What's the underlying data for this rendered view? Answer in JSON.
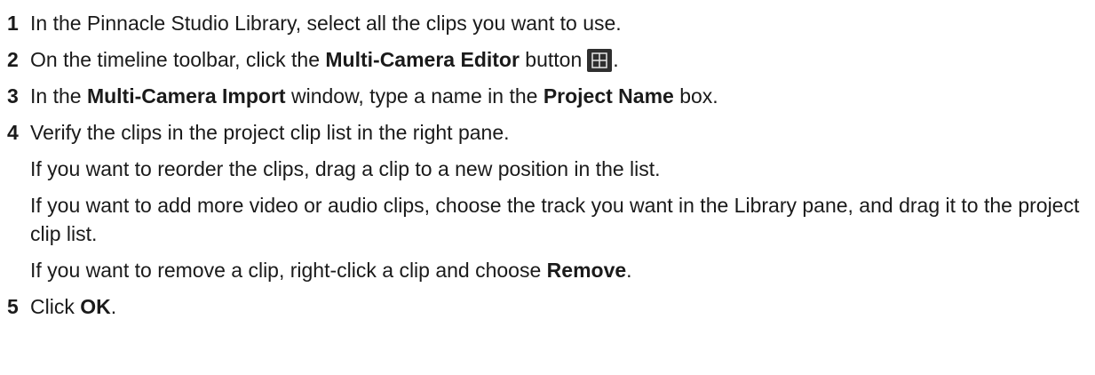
{
  "steps": [
    {
      "number": "1",
      "line": {
        "pre": "In the Pinnacle Studio Library, select all the clips you want to use."
      }
    },
    {
      "number": "2",
      "line": {
        "pre": "On the timeline toolbar, click the ",
        "bold": "Multi-Camera Editor",
        "mid": " button",
        "post": "."
      },
      "icon": "multi-camera-editor-icon"
    },
    {
      "number": "3",
      "line": {
        "pre": "In the ",
        "bold1": "Multi-Camera Import",
        "mid": " window, type a name in the ",
        "bold2": "Project Name",
        "post": " box."
      }
    },
    {
      "number": "4",
      "line": {
        "pre": "Verify the clips in the project clip list in the right pane."
      },
      "subs": [
        {
          "text": "If you want to reorder the clips, drag a clip to a new position in the list."
        },
        {
          "text": "If you want to add more video or audio clips, choose the track you want in the Library pane, and drag it to the project clip list."
        },
        {
          "pre": "If you want to remove a clip, right-click a clip and choose ",
          "bold": "Remove",
          "post": "."
        }
      ]
    },
    {
      "number": "5",
      "line": {
        "pre": "Click ",
        "bold": "OK",
        "post": "."
      }
    }
  ],
  "colors": {
    "text": "#1a1a1a",
    "icon_bg": "#2f2f2f",
    "icon_fg": "#e8e8e8"
  }
}
